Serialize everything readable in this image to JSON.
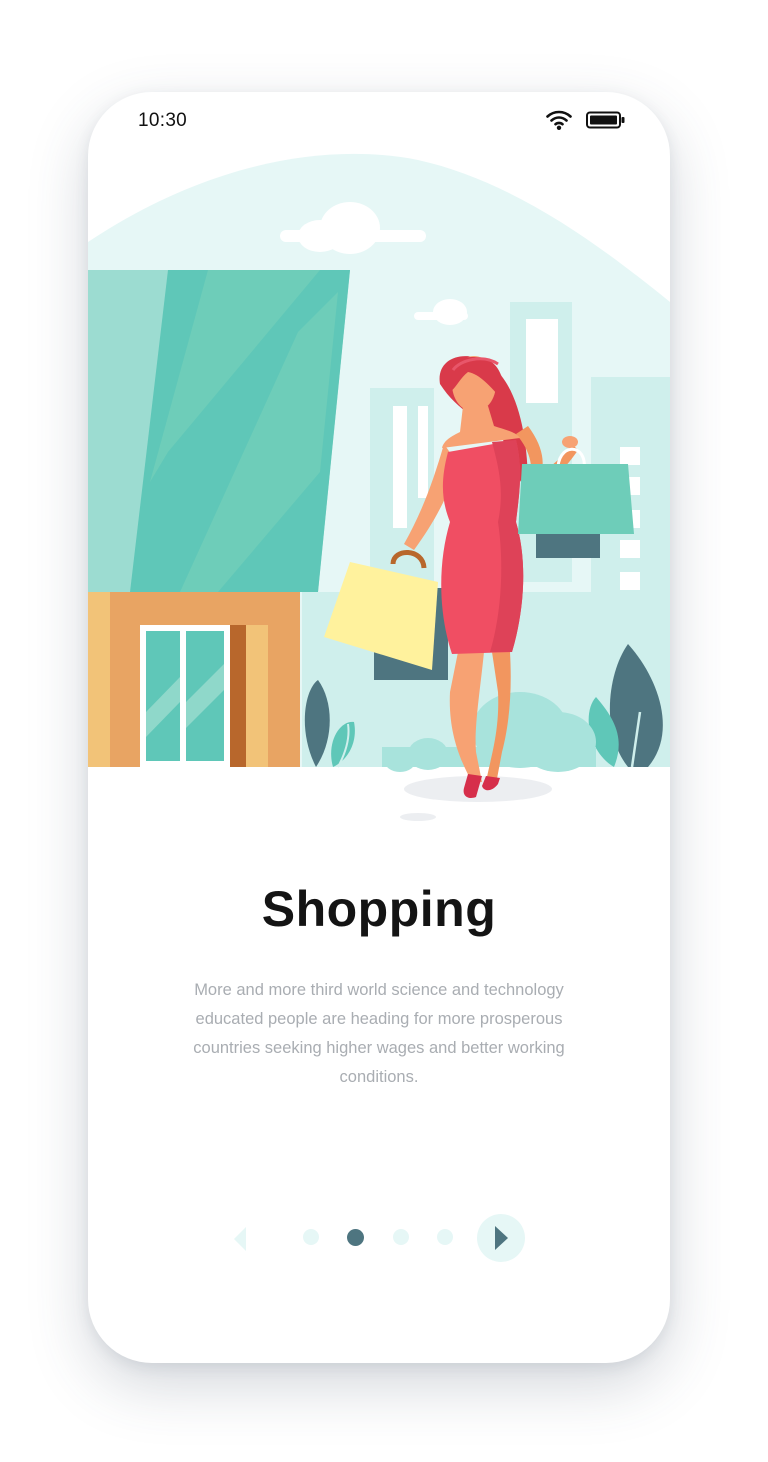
{
  "status_bar": {
    "time": "10:30"
  },
  "onboarding": {
    "title": "Shopping",
    "description": "More and more third world science and technology educated people are heading for more prosperous countries seeking higher wages and better working conditions."
  },
  "pagination": {
    "total": 4,
    "active_index": 1
  },
  "colors": {
    "accent": "#4e7580",
    "dot_inactive": "#e6f7f6",
    "sky": "#e6f7f6",
    "dress": "#f04e63",
    "hair": "#d93a4a",
    "building_glass": "#5fc7b8",
    "store_wall": "#e8a463"
  },
  "icons": {
    "prev": "chevron-left-icon",
    "next": "chevron-right-icon",
    "wifi": "wifi-icon",
    "battery": "battery-icon"
  }
}
